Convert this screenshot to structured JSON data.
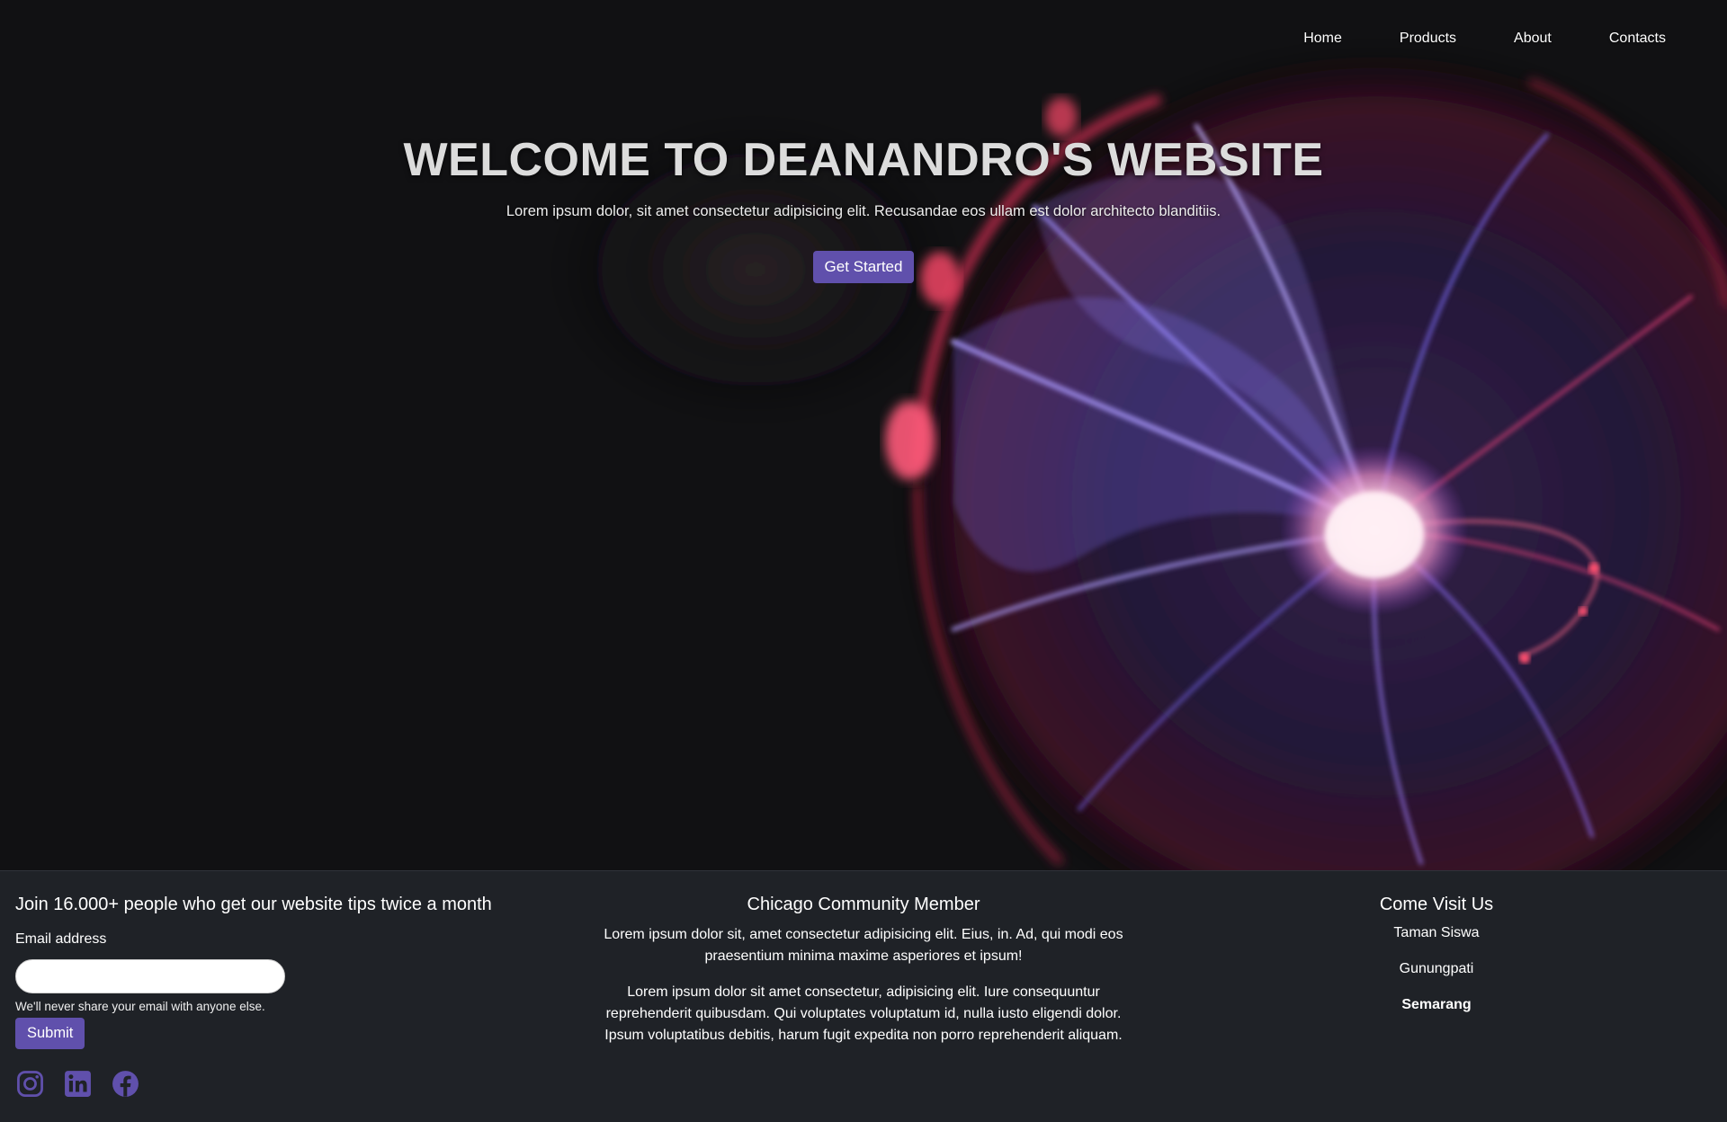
{
  "nav": {
    "items": [
      {
        "label": "Home"
      },
      {
        "label": "Products"
      },
      {
        "label": "About"
      },
      {
        "label": "Contacts"
      }
    ]
  },
  "hero": {
    "title": "WELCOME TO DEANANDRO'S WEBSITE",
    "subtitle": "Lorem ipsum dolor, sit amet consectetur adipisicing elit. Recusandae eos ullam est dolor architecto blanditiis.",
    "cta_label": "Get Started",
    "background": "plasma-ball-photo"
  },
  "newsletter": {
    "heading": "Join 16.000+ people who get our website tips twice a month",
    "email_label": "Email address",
    "email_value": "",
    "email_help": "We'll never share your email with anyone else.",
    "submit_label": "Submit"
  },
  "social": {
    "icons": [
      "instagram-icon",
      "linkedin-icon",
      "facebook-icon"
    ]
  },
  "community": {
    "heading": "Chicago Community Member",
    "paragraph1": "Lorem ipsum dolor sit, amet consectetur adipisicing elit. Eius, in. Ad, qui modi eos praesentium minima maxime asperiores et ipsum!",
    "paragraph2": "Lorem ipsum dolor sit amet consectetur, adipisicing elit. Iure consequuntur reprehenderit quibusdam. Qui voluptates voluptatum id, nulla iusto eligendi dolor. Ipsum voluptatibus debitis, harum fugit expedita non porro reprehenderit aliquam."
  },
  "visit": {
    "heading": "Come Visit Us",
    "locations": [
      "Taman Siswa",
      "Gunungpati",
      "Semarang"
    ]
  },
  "colors": {
    "accent": "#6050ac",
    "footer_bg": "#1f2227",
    "hero_bg": "#111113"
  }
}
